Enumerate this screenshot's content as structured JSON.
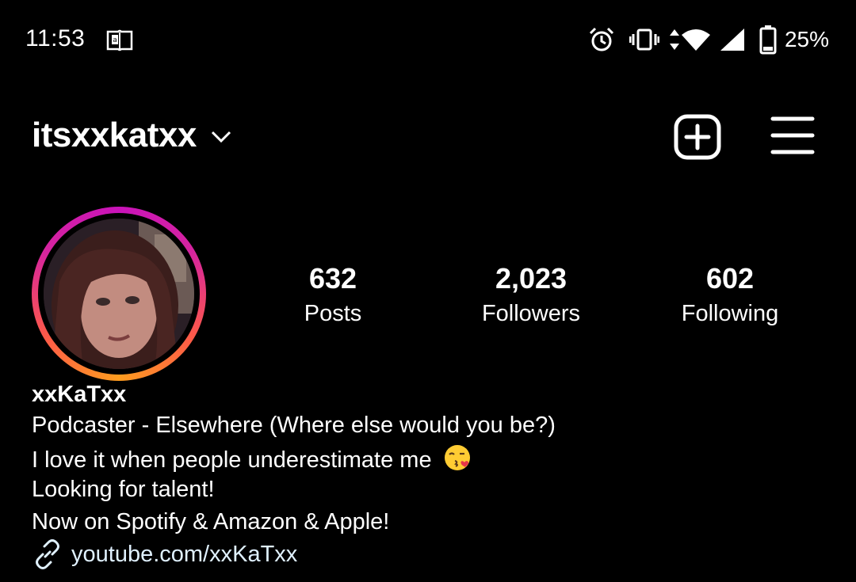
{
  "status_bar": {
    "time": "11:53",
    "battery_percent": "25%",
    "icons": [
      "book-icon",
      "alarm-icon",
      "vibrate-icon",
      "data-arrows-icon",
      "wifi-icon",
      "cell-signal-icon",
      "battery-icon"
    ]
  },
  "header": {
    "username": "itsxxkatxx",
    "icons": [
      "chevron-down-icon",
      "plus-square-icon",
      "hamburger-menu-icon"
    ]
  },
  "profile": {
    "stats": [
      {
        "count": "632",
        "label": "Posts"
      },
      {
        "count": "2,023",
        "label": "Followers"
      },
      {
        "count": "602",
        "label": "Following"
      }
    ],
    "display_name": "xxKaTxx",
    "bio": [
      "Podcaster - Elsewhere (Where else would you be?)",
      "I love it when people underestimate me",
      "Looking for talent!",
      "Now on Spotify & Amazon & Apple!"
    ],
    "bio_emoji": "kissing-face-emoji",
    "link": "youtube.com/xxKaTxx"
  },
  "colors": {
    "background": "#000000",
    "text": "#ffffff",
    "link": "#e0f1ff",
    "story_ring": [
      "#ff9d1f",
      "#fd5949",
      "#d6249f",
      "#c913b9"
    ]
  }
}
